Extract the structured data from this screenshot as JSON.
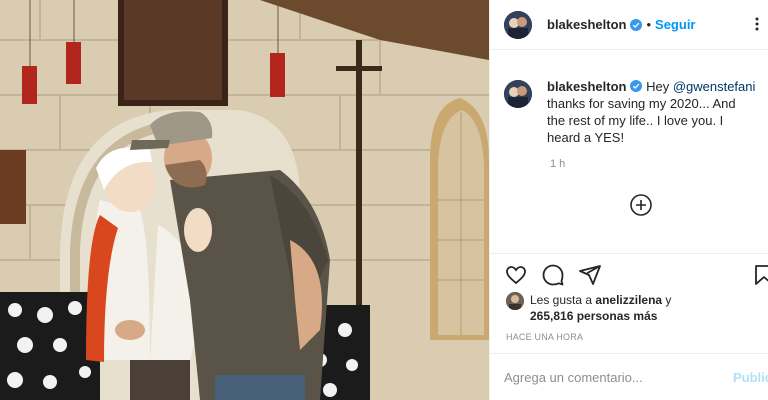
{
  "post": {
    "author": "blakeshelton",
    "follow_label": "Seguir",
    "header_dot": "•",
    "caption": {
      "username": "blakeshelton",
      "text_before": " Hey ",
      "mention": "@gwenstefani",
      "text_after": " thanks for saving my 2020... And the rest of my life.. I love you. I heard a YES!"
    },
    "time": "1 h",
    "likes": {
      "prefix": "Les gusta a ",
      "liker": "anelizzilena",
      "middle": " y ",
      "count": "265,816 personas más"
    },
    "posted": "HACE UNA HORA",
    "comment": {
      "placeholder": "Agrega un comentario...",
      "publish_label": "Publicar"
    }
  },
  "icons": {
    "verified": "verified-badge-icon",
    "more": "more-options-icon",
    "like": "heart-icon",
    "comment": "comment-icon",
    "share": "share-icon",
    "save": "bookmark-icon",
    "load_more": "plus-circle-icon"
  },
  "colors": {
    "link": "#0095f6",
    "verified": "#3897f0",
    "mention": "#00376b",
    "publish_disabled": "#b2dffc"
  }
}
